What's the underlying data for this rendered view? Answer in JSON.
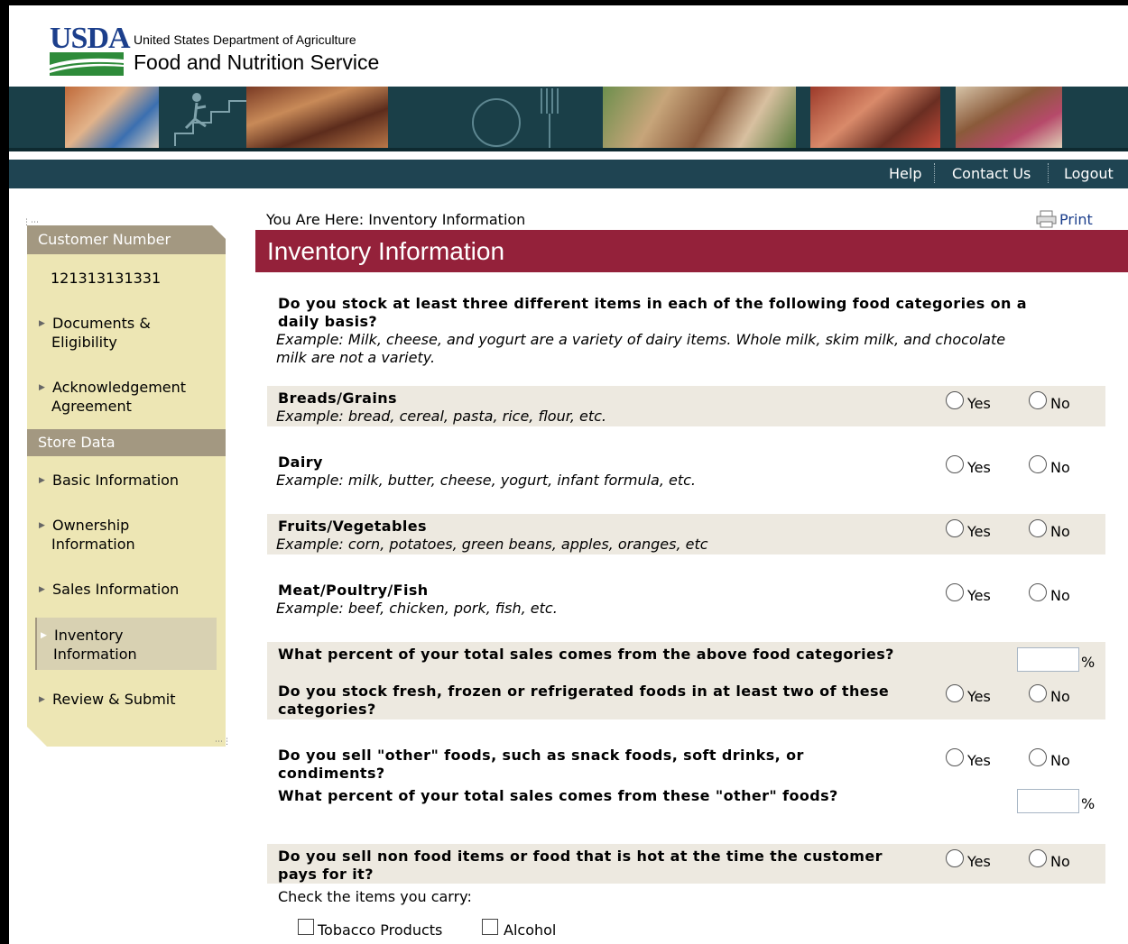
{
  "header": {
    "logo_text": "USDA",
    "dept_name": "United States Department of Agriculture",
    "agency_name": "Food and Nutrition Service"
  },
  "nav": {
    "help": "Help",
    "contact": "Contact Us",
    "logout": "Logout"
  },
  "sidebar": {
    "customer_header": "Customer Number",
    "customer_number": "121313131331",
    "items1": [
      {
        "label_1": "Documents &",
        "label_2": "Eligibility"
      },
      {
        "label_1": "Acknowledgement",
        "label_2": "Agreement"
      }
    ],
    "store_header": "Store Data",
    "items2": [
      {
        "label_1": "Basic Information",
        "label_2": ""
      },
      {
        "label_1": "Ownership",
        "label_2": "Information"
      },
      {
        "label_1": "Sales Information",
        "label_2": ""
      },
      {
        "label_1": "Inventory",
        "label_2": "Information"
      },
      {
        "label_1": "Review & Submit",
        "label_2": ""
      }
    ]
  },
  "breadcrumb": "You Are Here: Inventory Information",
  "print_label": "Print",
  "page_title": "Inventory Information",
  "intro": {
    "question_1": "Do you stock at least three different items in each of the following food categories on a",
    "question_2": "daily basis?",
    "example_1": "Example: Milk, cheese, and yogurt are a variety of dairy items. Whole milk, skim milk, and chocolate",
    "example_2": "milk are not a variety."
  },
  "categories": [
    {
      "name": "Breads/Grains",
      "example": "Example: bread, cereal, pasta, rice, flour, etc."
    },
    {
      "name": "Dairy",
      "example": "Example: milk, butter, cheese, yogurt, infant formula, etc."
    },
    {
      "name": "Fruits/Vegetables",
      "example": "Example: corn, potatoes, green beans, apples, oranges, etc"
    },
    {
      "name": "Meat/Poultry/Fish",
      "example": "Example: beef, chicken, pork, fish, etc."
    }
  ],
  "radio_yes": "Yes",
  "radio_no": "No",
  "percent_sign": "%",
  "q_percent_above": "What percent of your total sales comes from the above food categories?",
  "q_fresh_1": "Do you stock fresh, frozen or refrigerated foods in at least two of these",
  "q_fresh_2": "categories?",
  "q_other_1": "Do you sell \"other\" foods, such as snack foods, soft drinks, or",
  "q_other_2": "condiments?",
  "q_percent_other": "What percent of your total sales comes from these \"other\" foods?",
  "q_nonfood_1": "Do you sell non food items or food that is hot at the time the customer",
  "q_nonfood_2": "pays for it?",
  "check_items_label": "Check the items you carry:",
  "check_items": [
    "Tobacco Products",
    "Alcohol"
  ],
  "colors": {
    "title_bar": "#94213a",
    "nav_bar": "#1f4452",
    "sidebar_bg": "#ede6b4",
    "sidebar_header": "#a39881",
    "row_shade": "#ede9e0"
  }
}
